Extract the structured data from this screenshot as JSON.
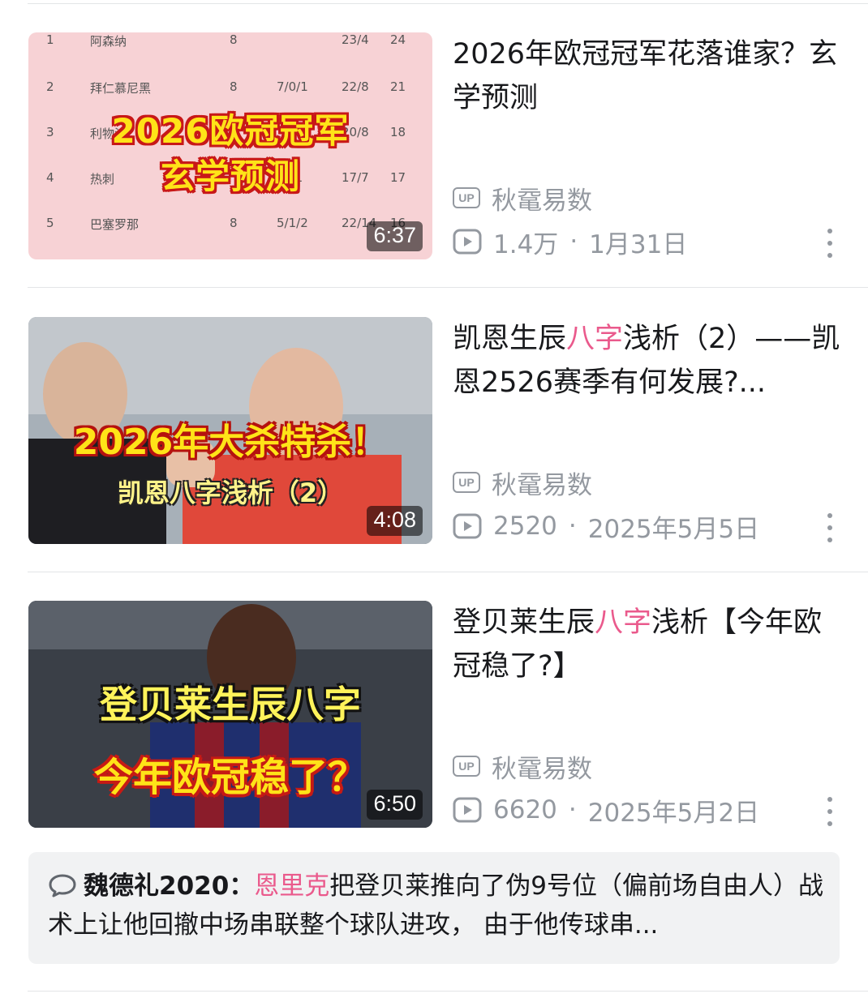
{
  "videos": [
    {
      "title_parts": [
        "2026年欧冠冠军花落谁家？玄学预测"
      ],
      "duration": "6:37",
      "uploader": "秋鼋易数",
      "views": "1.4万",
      "date": "1月31日",
      "thumb": {
        "rows": [
          {
            "rank": "1",
            "team": "阿森纳",
            "played": "8",
            "record": "",
            "goals": "23/4",
            "pts": "24"
          },
          {
            "rank": "2",
            "team": "拜仁慕尼黑",
            "played": "8",
            "record": "7/0/1",
            "goals": "22/8",
            "pts": "21"
          },
          {
            "rank": "3",
            "team": "利物浦",
            "played": "8",
            "record": "",
            "goals": "20/8",
            "pts": "18"
          },
          {
            "rank": "4",
            "team": "热刺",
            "played": "",
            "record": "2/1",
            "goals": "17/7",
            "pts": "17"
          },
          {
            "rank": "5",
            "team": "巴塞罗那",
            "played": "8",
            "record": "5/1/2",
            "goals": "22/14",
            "pts": "16"
          }
        ],
        "line1": "2026欧冠冠军",
        "line2": "玄学预测"
      }
    },
    {
      "title_before": "凯恩生辰",
      "title_highlight": "八字",
      "title_after": "浅析（2）——凯恩2526赛季有何发展?...",
      "duration": "4:08",
      "uploader": "秋鼋易数",
      "views": "2520",
      "date": "2025年5月5日",
      "thumb": {
        "line1": "2026年大杀特杀！",
        "line2": "凯恩八字浅析（2）"
      }
    },
    {
      "title_before": "登贝莱生辰",
      "title_highlight": "八字",
      "title_after": "浅析【今年欧冠稳了?】",
      "duration": "6:50",
      "uploader": "秋鼋易数",
      "views": "6620",
      "date": "2025年5月2日",
      "thumb": {
        "line1": "登贝莱生辰八字",
        "line2": "今年欧冠稳了？"
      }
    }
  ],
  "labels": {
    "up_badge": "UP",
    "dot_sep": "·"
  },
  "comment": {
    "user": "魏德礼2020：",
    "highlight": "恩里克",
    "text": "把登贝莱推向了伪9号位（偏前场自由人）战术上让他回撤中场串联整个球队进攻， 由于他传球串..."
  },
  "colors": {
    "accent_pink": "#ea5a8c",
    "meta_gray": "#9499a0"
  },
  "icons": [
    "up-badge-icon",
    "play-count-icon",
    "more-vertical-icon",
    "comment-bubble-icon"
  ]
}
